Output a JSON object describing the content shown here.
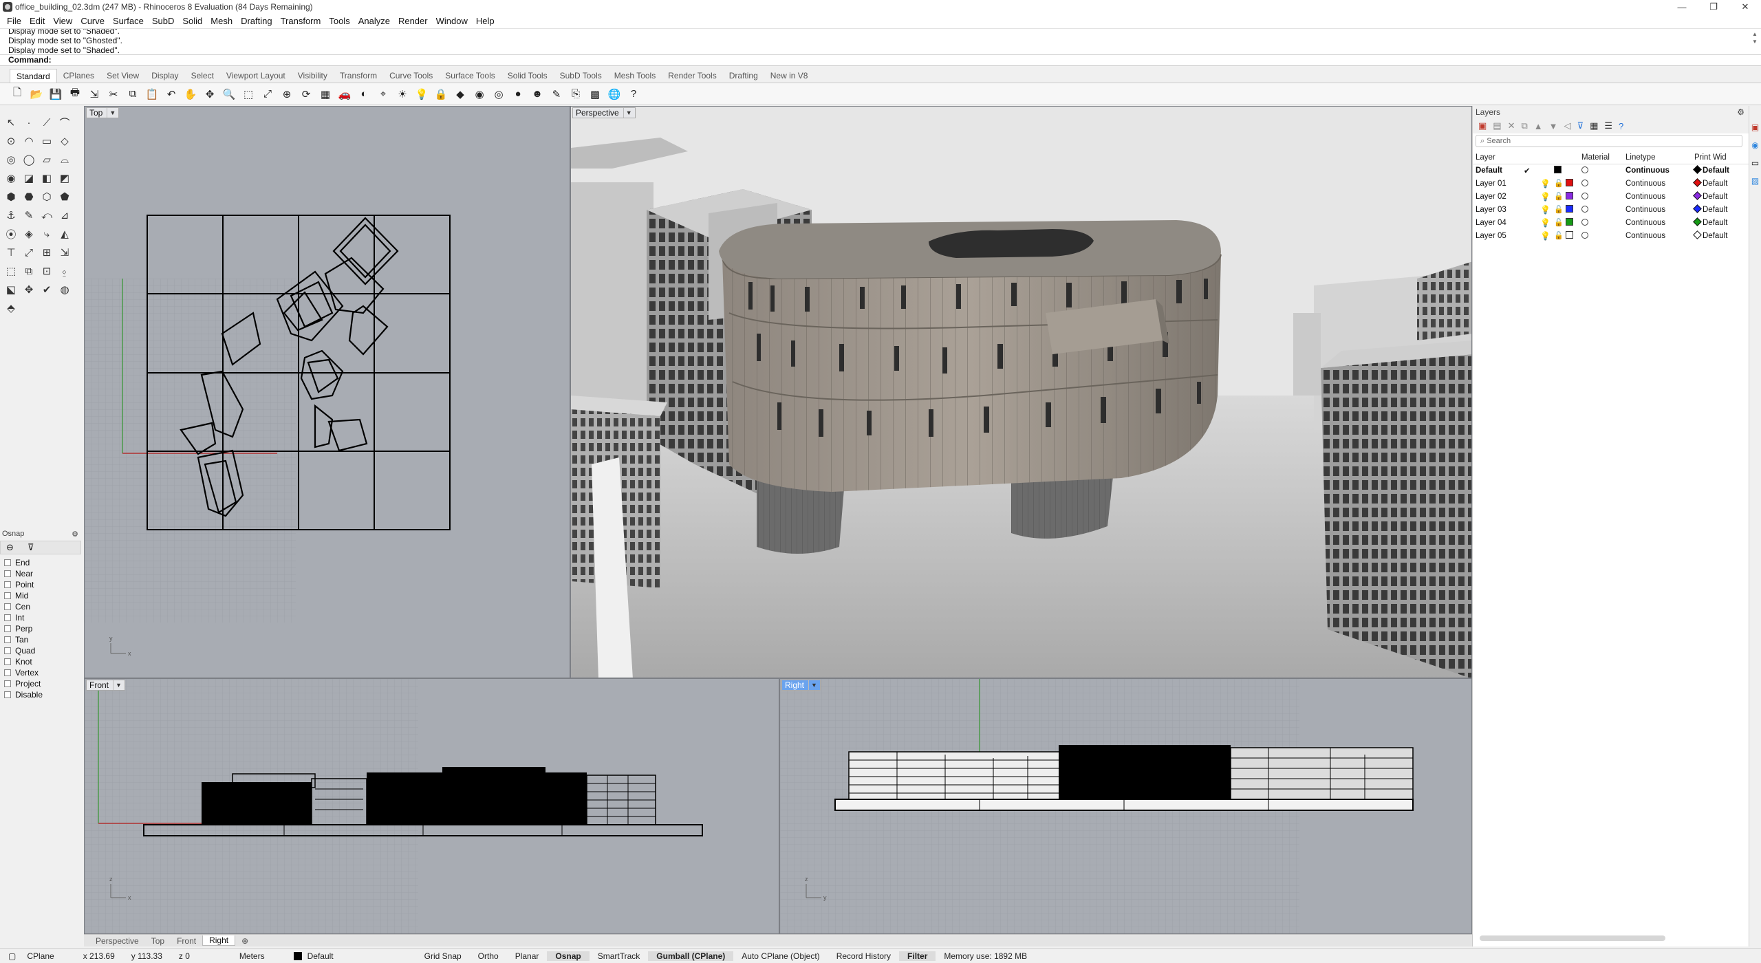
{
  "window": {
    "title": "office_building_02.3dm (247 MB) - Rhinoceros 8 Evaluation (84 Days Remaining)",
    "controls": [
      "—",
      "❐",
      "✕"
    ]
  },
  "menu": [
    "File",
    "Edit",
    "View",
    "Curve",
    "Surface",
    "SubD",
    "Solid",
    "Mesh",
    "Drafting",
    "Transform",
    "Tools",
    "Analyze",
    "Render",
    "Window",
    "Help"
  ],
  "command": {
    "history": [
      "Display mode set to \"Shaded\".",
      "Display mode set to \"Ghosted\".",
      "Display mode set to \"Shaded\"."
    ],
    "prompt": "Command:"
  },
  "toolbar_tabs": [
    "Standard",
    "CPlanes",
    "Set View",
    "Display",
    "Select",
    "Viewport Layout",
    "Visibility",
    "Transform",
    "Curve Tools",
    "Surface Tools",
    "Solid Tools",
    "SubD Tools",
    "Mesh Tools",
    "Render Tools",
    "Drafting",
    "New in V8"
  ],
  "active_toolbar_tab": "Standard",
  "toolbar_icons": [
    "new-file-icon",
    "open-icon",
    "save-icon",
    "print-icon",
    "import-icon",
    "cut-icon",
    "copy-icon",
    "paste-icon",
    "undo-icon",
    "pan-icon",
    "move-icon",
    "zoom-icon",
    "zoom-window-icon",
    "zoom-extents-icon",
    "zoom-selected-icon",
    "rotate-view-icon",
    "viewport-layout-icon",
    "car-icon",
    "render-preview-icon",
    "cplane-icon",
    "light-icon",
    "bulb-icon",
    "lock-icon",
    "material-icon",
    "color-wheel-icon",
    "ghost-icon",
    "sphere-icon",
    "render-icon",
    "pen-icon",
    "snapshot-icon",
    "grid-icon",
    "globe-icon",
    "help-icon"
  ],
  "toolbar_glyphs": [
    "🗋",
    "📂",
    "💾",
    "🖶",
    "⇲",
    "✂",
    "⧉",
    "📋",
    "↶",
    "✋",
    "✥",
    "🔍",
    "⬚",
    "⤢",
    "⊕",
    "⟳",
    "▦",
    "🚗",
    "◐",
    "⌖",
    "☀",
    "💡",
    "🔒",
    "◆",
    "◉",
    "◎",
    "●",
    "☻",
    "✎",
    "⎘",
    "▩",
    "🌐",
    "?"
  ],
  "palette_glyphs": [
    "↖",
    "·",
    "⟋",
    "⌒",
    "⊙",
    "◠",
    "▭",
    "◇",
    "◎",
    "◯",
    "▱",
    "⌓",
    "◉",
    "◪",
    "◧",
    "◩",
    "⬢",
    "⬣",
    "⬡",
    "⬟",
    "⚓",
    "✎",
    "⤺",
    "⊿",
    "⦿",
    "◈",
    "⤷",
    "◭",
    "⊤",
    "⤢",
    "⊞",
    "⇲",
    "⬚",
    "⧉",
    "⊡",
    "⍚",
    "⬕",
    "✥",
    "✔",
    "◍",
    "⬘"
  ],
  "osnap": {
    "title": "Osnap",
    "options": [
      "End",
      "Near",
      "Point",
      "Mid",
      "Cen",
      "Int",
      "Perp",
      "Tan",
      "Quad",
      "Knot",
      "Vertex",
      "Project",
      "Disable"
    ]
  },
  "viewports": {
    "top": {
      "label": "Top"
    },
    "perspective": {
      "label": "Perspective"
    },
    "front": {
      "label": "Front"
    },
    "right": {
      "label": "Right"
    }
  },
  "viewport_tabs": [
    "Perspective",
    "Top",
    "Front",
    "Right"
  ],
  "active_viewport_tab": "Right",
  "add_tab_glyph": "⊕",
  "layers": {
    "title": "Layers",
    "search_placeholder": "Search",
    "columns": [
      "Layer",
      "",
      "",
      "",
      "Material",
      "Linetype",
      "Print Wid"
    ],
    "rows": [
      {
        "name": "Default",
        "current": true,
        "color": "#000000",
        "linetype": "Continuous",
        "print": "Default"
      },
      {
        "name": "Layer 01",
        "current": false,
        "color": "#e01010",
        "linetype": "Continuous",
        "print": "Default"
      },
      {
        "name": "Layer 02",
        "current": false,
        "color": "#8a2be2",
        "linetype": "Continuous",
        "print": "Default"
      },
      {
        "name": "Layer 03",
        "current": false,
        "color": "#1a2bff",
        "linetype": "Continuous",
        "print": "Default"
      },
      {
        "name": "Layer 04",
        "current": false,
        "color": "#169a16",
        "linetype": "Continuous",
        "print": "Default"
      },
      {
        "name": "Layer 05",
        "current": false,
        "color": "#ffffff",
        "linetype": "Continuous",
        "print": "Default"
      }
    ]
  },
  "status": {
    "cplane": "CPlane",
    "x": "x 213.69",
    "y": "y 113.33",
    "z": "z 0",
    "units": "Meters",
    "layer": "Default",
    "toggles": [
      {
        "label": "Grid Snap",
        "on": false
      },
      {
        "label": "Ortho",
        "on": false
      },
      {
        "label": "Planar",
        "on": false
      },
      {
        "label": "Osnap",
        "on": true
      },
      {
        "label": "SmartTrack",
        "on": false
      },
      {
        "label": "Gumball (CPlane)",
        "on": true
      },
      {
        "label": "Auto CPlane (Object)",
        "on": false
      },
      {
        "label": "Record History",
        "on": false
      },
      {
        "label": "Filter",
        "on": true
      }
    ],
    "memory": "Memory use: 1892 MB"
  }
}
